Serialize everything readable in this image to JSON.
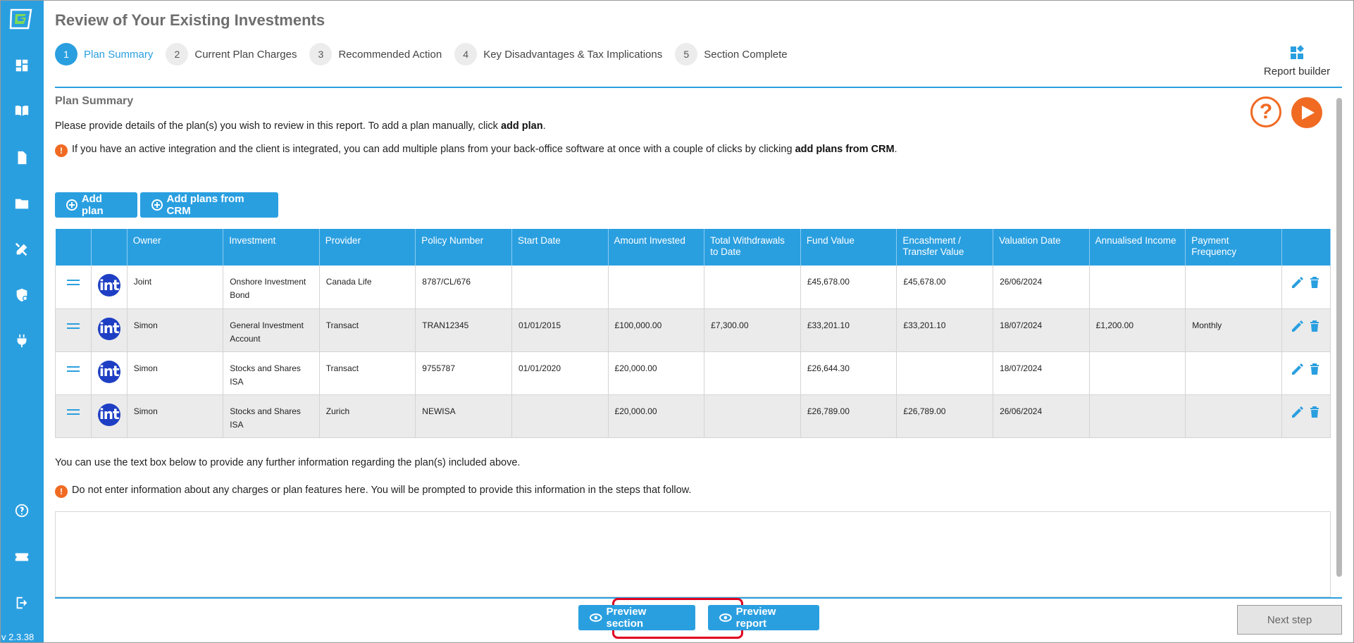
{
  "app": {
    "version": "v 2.3.38"
  },
  "sidebar": {
    "items": [
      {
        "name": "dashboard-icon"
      },
      {
        "name": "book-icon"
      },
      {
        "name": "document-icon"
      },
      {
        "name": "folder-icon"
      },
      {
        "name": "tools-icon"
      },
      {
        "name": "shield-icon"
      },
      {
        "name": "plug-icon"
      },
      {
        "name": "help-circle-icon"
      },
      {
        "name": "ticket-icon"
      },
      {
        "name": "logout-icon"
      }
    ]
  },
  "header": {
    "title": "Review of Your Existing Investments",
    "report_builder": "Report builder"
  },
  "steps": [
    {
      "num": "1",
      "label": "Plan Summary",
      "active": true
    },
    {
      "num": "2",
      "label": "Current Plan Charges"
    },
    {
      "num": "3",
      "label": "Recommended Action"
    },
    {
      "num": "4",
      "label": "Key Disadvantages & Tax Implications"
    },
    {
      "num": "5",
      "label": "Section Complete"
    }
  ],
  "section": {
    "title": "Plan Summary",
    "intro_before": "Please provide details of the plan(s) you wish to review in this report. To add a plan manually, click ",
    "intro_bold": "add plan",
    "intro_after": ".",
    "info_before": "If you have an active integration and the client is integrated, you can add multiple plans from your back-office software at once with a couple of clicks by clicking ",
    "info_bold": "add plans from CRM",
    "info_after": ".",
    "add_plan": "Add plan",
    "add_plans_crm": "Add plans from CRM",
    "further_info": "You can use the text box below to provide any further information regarding the plan(s) included above.",
    "warning": "Do not enter information about any charges or plan features here. You will be prompted to provide this information in the steps that follow."
  },
  "table": {
    "headers": [
      "Owner",
      "Investment",
      "Provider",
      "Policy Number",
      "Start Date",
      "Amount Invested",
      "Total Withdrawals to Date",
      "Fund Value",
      "Encashment / Transfer Value",
      "Valuation Date",
      "Annualised Income",
      "Payment Frequency"
    ],
    "logo_text": "int",
    "rows": [
      [
        "Joint",
        "Onshore Investment Bond",
        "Canada Life",
        "8787/CL/676",
        "",
        "",
        "",
        "£45,678.00",
        "£45,678.00",
        "26/06/2024",
        "",
        ""
      ],
      [
        "Simon",
        "General Investment Account",
        "Transact",
        "TRAN12345",
        "01/01/2015",
        "£100,000.00",
        "£7,300.00",
        "£33,201.10",
        "£33,201.10",
        "18/07/2024",
        "£1,200.00",
        "Monthly"
      ],
      [
        "Simon",
        "Stocks and Shares ISA",
        "Transact",
        "9755787",
        "01/01/2020",
        "£20,000.00",
        "",
        "£26,644.30",
        "",
        "18/07/2024",
        "",
        ""
      ],
      [
        "Simon",
        "Stocks and Shares ISA",
        "Zurich",
        "NEWISA",
        "",
        "£20,000.00",
        "",
        "£26,789.00",
        "£26,789.00",
        "26/06/2024",
        "",
        ""
      ]
    ]
  },
  "footer": {
    "preview_section": "Preview section",
    "preview_report": "Preview report",
    "next_step": "Next step"
  },
  "colors": {
    "accent": "#2a9fe0",
    "orange": "#f06a22",
    "highlight": "#e00020"
  }
}
